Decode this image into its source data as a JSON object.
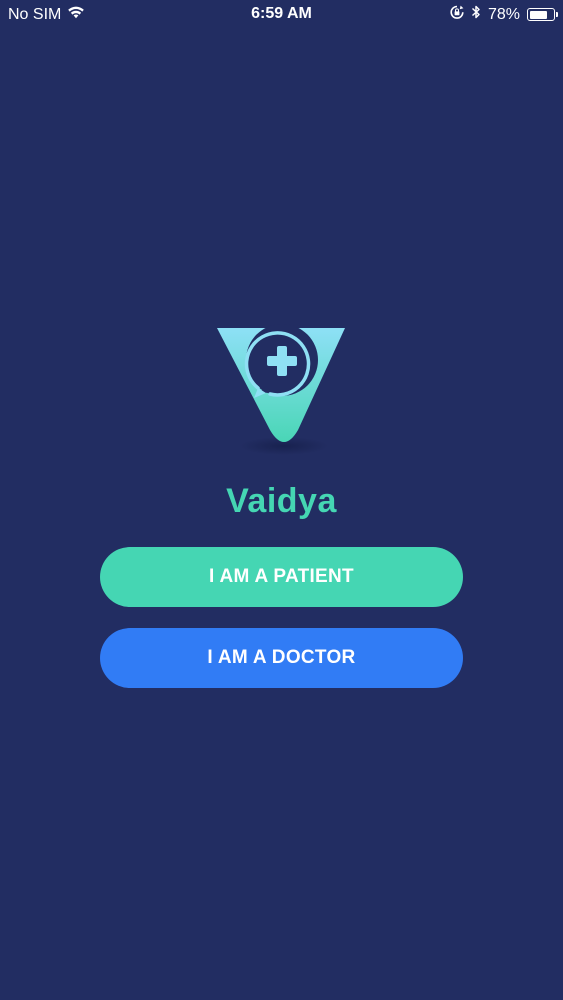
{
  "status_bar": {
    "carrier": "No SIM",
    "time": "6:59 AM",
    "battery_percent_label": "78%",
    "battery_level": 0.78,
    "icons": [
      "wifi-icon",
      "rotation-lock-icon",
      "bluetooth-icon",
      "battery-icon"
    ]
  },
  "app": {
    "name": "Vaidya",
    "logo_icon": "vaidya-logo-icon"
  },
  "buttons": {
    "patient_label": "I AM A PATIENT",
    "doctor_label": "I AM A DOCTOR"
  },
  "colors": {
    "background": "#222d62",
    "accent_teal": "#45d6b3",
    "accent_blue": "#317cf5",
    "logo_gradient_top": "#86dff4",
    "logo_gradient_bottom": "#4fd8b7",
    "text": "#ffffff"
  }
}
